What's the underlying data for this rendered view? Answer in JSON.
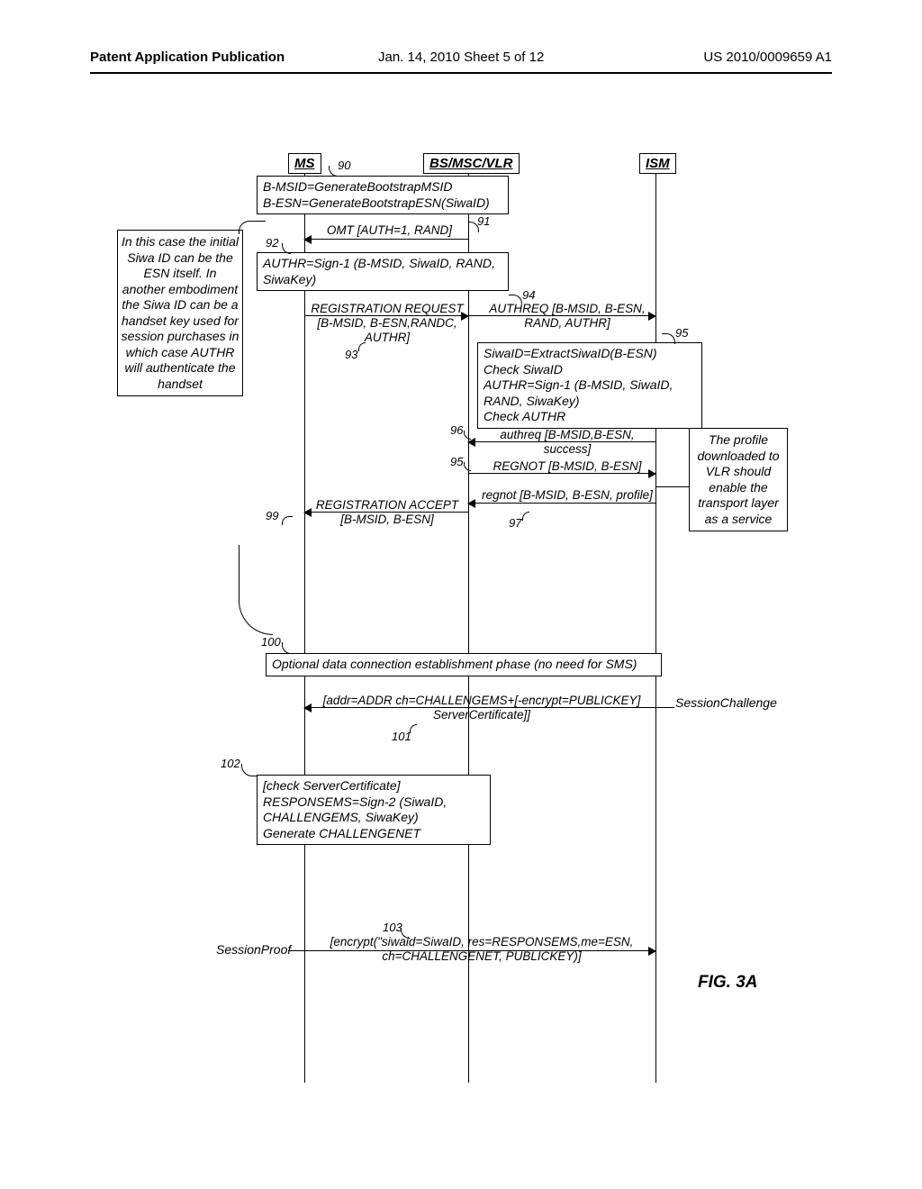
{
  "header": {
    "left": "Patent Application Publication",
    "mid": "Jan. 14, 2010  Sheet 5 of 12",
    "right": "US 2010/0009659 A1"
  },
  "actors": {
    "ms": "MS",
    "bs": "BS/MSC/VLR",
    "ism": "ISM"
  },
  "notes": {
    "left": "In this case the initial Siwa ID can be the ESN itself. In another embodiment the Siwa ID can be a handset key used for session purchases in which case AUTHR will authenticate the handset",
    "right": "The profile downloaded to VLR should enable the transport layer as a service"
  },
  "proc": {
    "p90": "B-MSID=GenerateBootstrapMSID\nB-ESN=GenerateBootstrapESN(SiwaID)",
    "p92": "AUTHR=Sign-1 (B-MSID, SiwaID, RAND, SiwaKey)",
    "p95b": "SiwaID=ExtractSiwaID(B-ESN)\nCheck SiwaID\nAUTHR=Sign-1 (B-MSID, SiwaID, RAND, SiwaKey)\nCheck AUTHR",
    "p100": "Optional data connection establishment phase (no need for SMS)",
    "p102": "[check ServerCertificate]\nRESPONSEMS=Sign-2 (SiwaID, CHALLENGEMS, SiwaKey)\nGenerate CHALLENGENET"
  },
  "msgs": {
    "m91": "OMT [AUTH=1, RAND]",
    "m93": "REGISTRATION REQUEST\n[B-MSID, B-ESN,RANDC, AUTHR]",
    "m94": "AUTHREQ [B-MSID, B-ESN, RAND, AUTHR]",
    "m96": "authreq [B-MSID,B-ESN, success]",
    "m95": "REGNOT [B-MSID, B-ESN]",
    "m97": "regnot [B-MSID, B-ESN, profile]",
    "m99": "REGISTRATION ACCEPT\n[B-MSID, B-ESN]",
    "m101": "[addr=ADDR ch=CHALLENGEMS+[-encrypt=PUBLICKEY] ServerCertificate]]",
    "m103": "[encrypt(\"siwaid=SiwaID, res=RESPONSEMS,me=ESN, ch=CHALLENGENET, PUBLICKEY)]"
  },
  "refs": {
    "r90": "90",
    "r91": "91",
    "r92": "92",
    "r93": "93",
    "r94": "94",
    "r95": "95",
    "r95b": "95",
    "r96": "96",
    "r97": "97",
    "r99": "99",
    "r100": "100",
    "r101": "101",
    "r102": "102",
    "r103": "103"
  },
  "side": {
    "sessionChallenge": "SessionChallenge",
    "sessionProof": "SessionProof"
  },
  "figure": "FIG. 3A"
}
